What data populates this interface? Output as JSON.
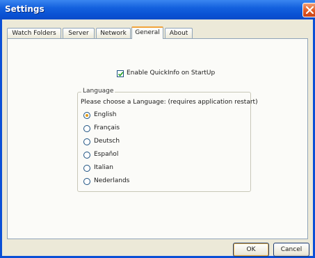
{
  "window": {
    "title": "Settings"
  },
  "tabs": [
    {
      "label": "Watch Folders",
      "active": false
    },
    {
      "label": "Server",
      "active": false
    },
    {
      "label": "Network",
      "active": false
    },
    {
      "label": "General",
      "active": true
    },
    {
      "label": "About",
      "active": false
    }
  ],
  "general": {
    "quickinfo_label": "Enable QuickInfo on StartUp",
    "quickinfo_checked": true,
    "language_group": {
      "legend": "Language",
      "prompt": "Please choose a Language: (requires application restart)",
      "options": [
        {
          "label": "English",
          "selected": true
        },
        {
          "label": "Français",
          "selected": false
        },
        {
          "label": "Deutsch",
          "selected": false
        },
        {
          "label": "Español",
          "selected": false
        },
        {
          "label": "Italian",
          "selected": false
        },
        {
          "label": "Nederlands",
          "selected": false
        }
      ]
    }
  },
  "buttons": {
    "ok": "OK",
    "cancel": "Cancel"
  },
  "colors": {
    "titlebar": "#0a52d4",
    "client_bg": "#ece9d8",
    "active_tab_accent": "#f2a43a",
    "close_button": "#e25a22",
    "checkmark": "#21a121",
    "radio_dot": "#e29c14"
  }
}
